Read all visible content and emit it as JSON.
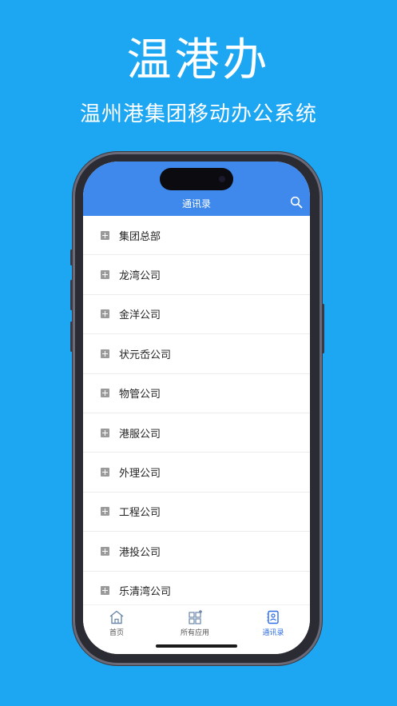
{
  "hero": {
    "title": "温港办",
    "subtitle": "温州港集团移动办公系统"
  },
  "screen": {
    "nav_title": "通讯录",
    "search_icon": "search-icon",
    "items": [
      {
        "label": "集团总部"
      },
      {
        "label": "龙湾公司"
      },
      {
        "label": "金洋公司"
      },
      {
        "label": "状元岙公司"
      },
      {
        "label": "物管公司"
      },
      {
        "label": "港服公司"
      },
      {
        "label": "外理公司"
      },
      {
        "label": "工程公司"
      },
      {
        "label": "港投公司"
      },
      {
        "label": "乐清湾公司"
      }
    ],
    "tabs": [
      {
        "label": "首页",
        "icon": "home-icon"
      },
      {
        "label": "所有应用",
        "icon": "apps-icon"
      },
      {
        "label": "通讯录",
        "icon": "contacts-icon",
        "active": true
      }
    ]
  },
  "colors": {
    "background": "#1da7f2",
    "header": "#3f89ec",
    "active_tab": "#2f6ee6"
  }
}
